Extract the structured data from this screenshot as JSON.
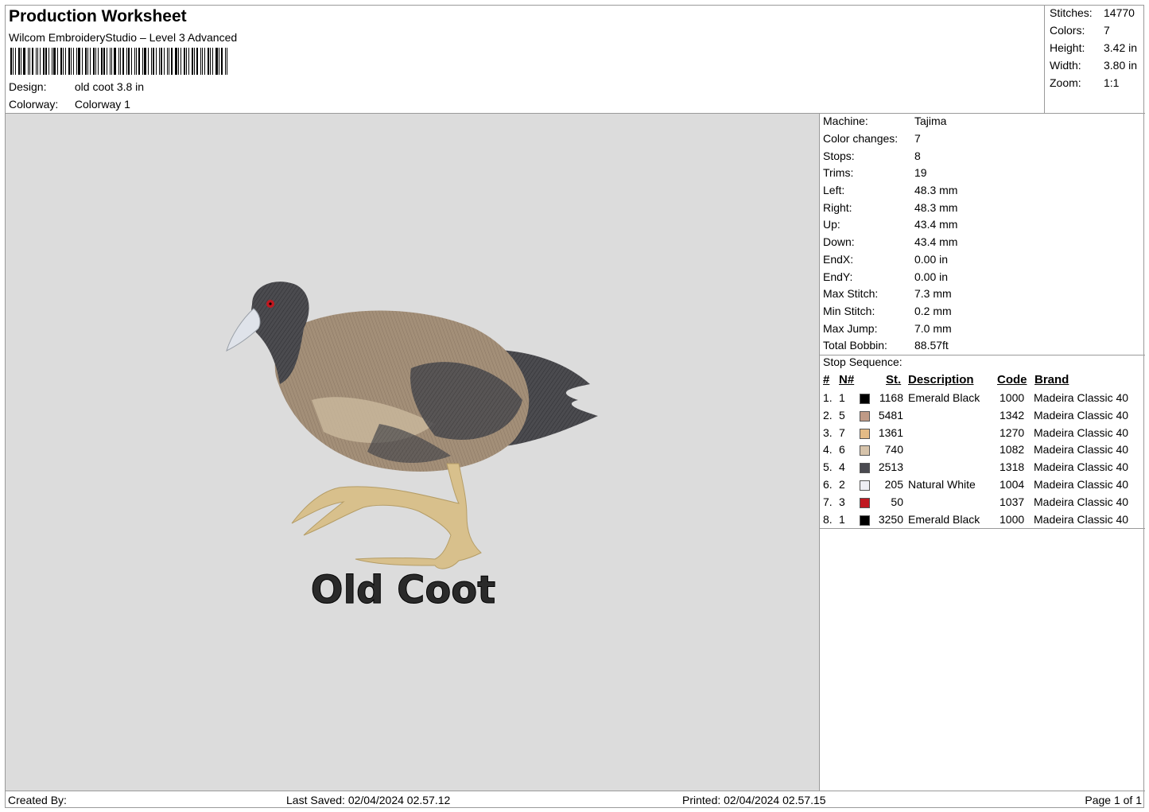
{
  "header": {
    "title": "Production Worksheet",
    "software": "Wilcom EmbroideryStudio – Level 3 Advanced",
    "design_label": "Design:",
    "design_value": "old coot 3.8 in",
    "colorway_label": "Colorway:",
    "colorway_value": "Colorway 1"
  },
  "stats": [
    {
      "label": "Stitches:",
      "value": "14770"
    },
    {
      "label": "Colors:",
      "value": "7"
    },
    {
      "label": "Height:",
      "value": "3.42 in"
    },
    {
      "label": "Width:",
      "value": "3.80 in"
    },
    {
      "label": "Zoom:",
      "value": "1:1"
    }
  ],
  "design": {
    "caption": "Old Coot"
  },
  "machine_info": [
    {
      "label": "Machine:",
      "value": "Tajima"
    },
    {
      "label": "Color changes:",
      "value": "7"
    },
    {
      "label": "Stops:",
      "value": "8"
    },
    {
      "label": "Trims:",
      "value": "19"
    },
    {
      "label": "Left:",
      "value": "48.3 mm"
    },
    {
      "label": "Right:",
      "value": "48.3 mm"
    },
    {
      "label": "Up:",
      "value": "43.4 mm"
    },
    {
      "label": "Down:",
      "value": "43.4 mm"
    },
    {
      "label": "EndX:",
      "value": "0.00 in"
    },
    {
      "label": "EndY:",
      "value": "0.00 in"
    },
    {
      "label": "Max Stitch:",
      "value": "7.3 mm"
    },
    {
      "label": "Min Stitch:",
      "value": "0.2 mm"
    },
    {
      "label": "Max Jump:",
      "value": "7.0 mm"
    },
    {
      "label": "Total Bobbin:",
      "value": "88.57ft"
    }
  ],
  "stop_sequence": {
    "title": "Stop Sequence:",
    "headers": {
      "num": "#",
      "n": "N#",
      "st": "St.",
      "description": "Description",
      "code": "Code",
      "brand": "Brand"
    },
    "rows": [
      {
        "num": "1.",
        "n": "1",
        "color": "#000000",
        "st": "1168",
        "description": "Emerald Black",
        "code": "1000",
        "brand": "Madeira Classic 40"
      },
      {
        "num": "2.",
        "n": "5",
        "color": "#bf9a86",
        "st": "5481",
        "description": "",
        "code": "1342",
        "brand": "Madeira Classic 40"
      },
      {
        "num": "3.",
        "n": "7",
        "color": "#e3bb86",
        "st": "1361",
        "description": "",
        "code": "1270",
        "brand": "Madeira Classic 40"
      },
      {
        "num": "4.",
        "n": "6",
        "color": "#d6c3aa",
        "st": "740",
        "description": "",
        "code": "1082",
        "brand": "Madeira Classic 40"
      },
      {
        "num": "5.",
        "n": "4",
        "color": "#4a4a50",
        "st": "2513",
        "description": "",
        "code": "1318",
        "brand": "Madeira Classic 40"
      },
      {
        "num": "6.",
        "n": "2",
        "color": "#eeeef4",
        "st": "205",
        "description": "Natural White",
        "code": "1004",
        "brand": "Madeira Classic 40"
      },
      {
        "num": "7.",
        "n": "3",
        "color": "#c01820",
        "st": "50",
        "description": "",
        "code": "1037",
        "brand": "Madeira Classic 40"
      },
      {
        "num": "8.",
        "n": "1",
        "color": "#000000",
        "st": "3250",
        "description": "Emerald Black",
        "code": "1000",
        "brand": "Madeira Classic 40"
      }
    ]
  },
  "footer": {
    "created_by": "Created By:",
    "last_saved": "Last Saved: 02/04/2024 02.57.12",
    "printed": "Printed: 02/04/2024 02.57.15",
    "page": "Page 1 of 1"
  }
}
